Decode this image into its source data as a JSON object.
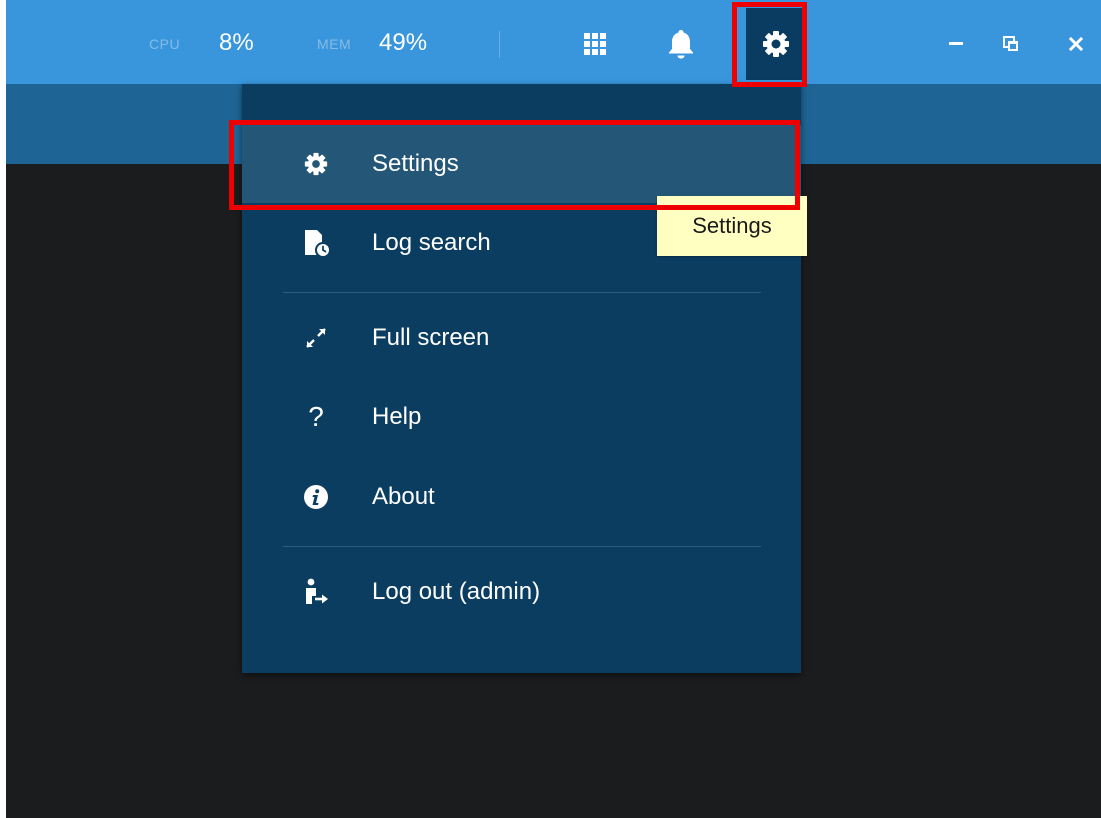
{
  "topbar": {
    "cpu_label": "CPU",
    "cpu_value": "8%",
    "mem_label": "MEM",
    "mem_value": "49%",
    "icons": [
      "grid-icon",
      "bell-icon",
      "gear-icon",
      "minimize-icon",
      "restore-icon",
      "close-icon"
    ]
  },
  "menu": {
    "items": [
      {
        "label": "Settings",
        "icon": "gear-icon",
        "active": true
      },
      {
        "label": "Log search",
        "icon": "log-search-icon"
      },
      {
        "label": "Full screen",
        "icon": "fullscreen-icon"
      },
      {
        "label": "Help",
        "icon": "help-icon",
        "glyph": "?"
      },
      {
        "label": "About",
        "icon": "info-icon"
      },
      {
        "label": "Log out (admin)",
        "icon": "logout-icon"
      }
    ]
  },
  "tooltip": {
    "text": "Settings"
  },
  "colors": {
    "topbar": "#3996dc",
    "subbar": "#1e6595",
    "menu_bg": "#0b3d61",
    "menu_active": "#245777",
    "highlight": "#ef0000",
    "tooltip_bg": "#ffffc2",
    "workspace": "#1b1c1e"
  }
}
